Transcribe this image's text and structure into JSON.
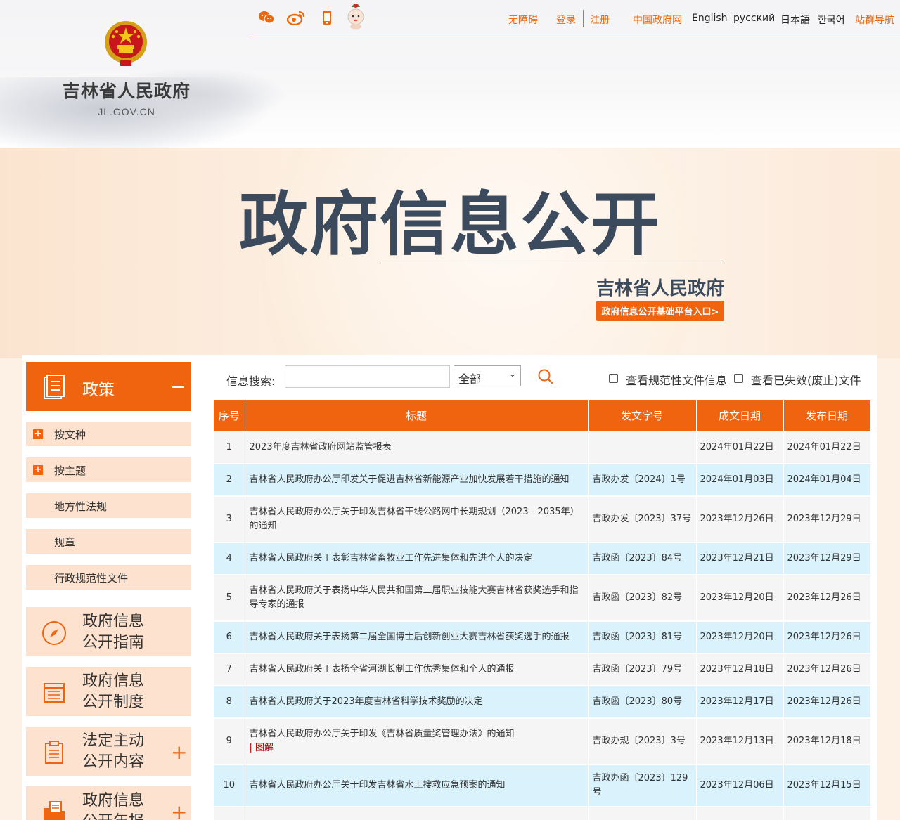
{
  "header": {
    "site_name": "吉林省人民政府",
    "site_domain": "JL.GOV.CN",
    "top_links": {
      "accessibility": "无障碍",
      "login": "登录",
      "register": "注册",
      "central_gov": "中国政府网",
      "english": "English",
      "russian": "русский",
      "japanese": "日本語",
      "korean": "한국어",
      "site_group": "站群导航"
    },
    "social_icons": [
      "wechat-icon",
      "weibo-icon",
      "mobile-icon",
      "mascot-icon"
    ]
  },
  "banner": {
    "title": "政府信息公开",
    "subtitle": "吉林省人民政府",
    "entry_button": "政府信息公开基础平台入口>"
  },
  "sidebar": {
    "head": "政策",
    "sub_items": [
      {
        "label": "按文种",
        "expandable": true
      },
      {
        "label": "按主题",
        "expandable": true
      },
      {
        "label": "地方性法规",
        "expandable": false
      },
      {
        "label": "规章",
        "expandable": false
      },
      {
        "label": "行政规范性文件",
        "expandable": false
      }
    ],
    "big_items": [
      {
        "line1": "政府信息",
        "line2": "公开指南",
        "expandable": false
      },
      {
        "line1": "政府信息",
        "line2": "公开制度",
        "expandable": false
      },
      {
        "line1": "法定主动",
        "line2": "公开内容",
        "expandable": true
      },
      {
        "line1": "政府信息",
        "line2": "公开年报",
        "expandable": true
      }
    ]
  },
  "search": {
    "label": "信息搜索:",
    "input_value": "",
    "select_value": "全部",
    "checkbox_normative": "查看规范性文件信息",
    "checkbox_invalid": "查看已失效(废止)文件"
  },
  "table": {
    "headers": [
      "序号",
      "标题",
      "发文字号",
      "成文日期",
      "发布日期"
    ],
    "rows": [
      {
        "no": "1",
        "title": "2023年度吉林省政府网站监管报表",
        "doc_no": "",
        "written": "2024年01月22日",
        "published": "2024年01月22日"
      },
      {
        "no": "2",
        "title": "吉林省人民政府办公厅印发关于促进吉林省新能源产业加快发展若干措施的通知",
        "doc_no": "吉政办发〔2024〕1号",
        "written": "2024年01月03日",
        "published": "2024年01月04日"
      },
      {
        "no": "3",
        "title": "吉林省人民政府办公厅关于印发吉林省干线公路网中长期规划（2023 - 2035年）的通知",
        "doc_no": "吉政办发〔2023〕37号",
        "written": "2023年12月26日",
        "published": "2023年12月29日"
      },
      {
        "no": "4",
        "title": "吉林省人民政府关于表彰吉林省畜牧业工作先进集体和先进个人的决定",
        "doc_no": "吉政函〔2023〕84号",
        "written": "2023年12月21日",
        "published": "2023年12月29日"
      },
      {
        "no": "5",
        "title": "吉林省人民政府关于表扬中华人民共和国第二届职业技能大赛吉林省获奖选手和指导专家的通报",
        "doc_no": "吉政函〔2023〕82号",
        "written": "2023年12月20日",
        "published": "2023年12月26日"
      },
      {
        "no": "6",
        "title": "吉林省人民政府关于表扬第二届全国博士后创新创业大赛吉林省获奖选手的通报",
        "doc_no": "吉政函〔2023〕81号",
        "written": "2023年12月20日",
        "published": "2023年12月26日"
      },
      {
        "no": "7",
        "title": "吉林省人民政府关于表扬全省河湖长制工作优秀集体和个人的通报",
        "doc_no": "吉政函〔2023〕79号",
        "written": "2023年12月18日",
        "published": "2023年12月26日"
      },
      {
        "no": "8",
        "title": "吉林省人民政府关于2023年度吉林省科学技术奖励的决定",
        "doc_no": "吉政函〔2023〕80号",
        "written": "2023年12月17日",
        "published": "2023年12月26日"
      },
      {
        "no": "9",
        "title": "吉林省人民政府办公厅关于印发《吉林省质量奖管理办法》的通知",
        "extra": "| 图解",
        "doc_no": "吉政办规〔2023〕3号",
        "written": "2023年12月13日",
        "published": "2023年12月18日"
      },
      {
        "no": "10",
        "title": "吉林省人民政府办公厅关于印发吉林省水上搜救应急预案的通知",
        "doc_no": "吉政办函〔2023〕129号",
        "written": "2023年12月06日",
        "published": "2023年12月15日"
      }
    ]
  },
  "colors": {
    "accent": "#f0630f",
    "row_odd": "#f5f5f5",
    "row_even": "#d9f2fb",
    "banner_title": "#3b4a5c"
  }
}
